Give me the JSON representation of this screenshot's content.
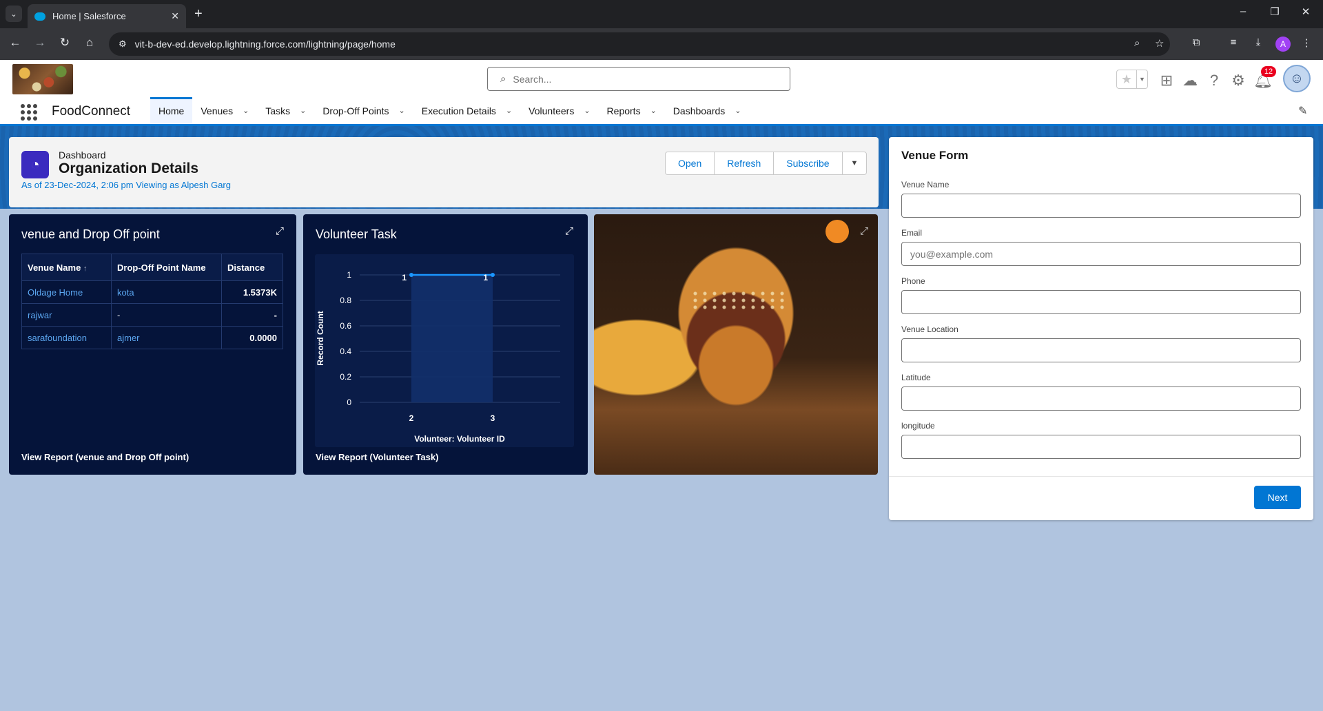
{
  "browser": {
    "tab_title": "Home | Salesforce",
    "url": "vit-b-dev-ed.develop.lightning.force.com/lightning/page/home",
    "profile_initial": "A"
  },
  "header": {
    "search_placeholder": "Search...",
    "notification_count": "12"
  },
  "nav": {
    "app_name": "FoodConnect",
    "items": [
      {
        "label": "Home",
        "active": true,
        "dropdown": false
      },
      {
        "label": "Venues",
        "active": false,
        "dropdown": true
      },
      {
        "label": "Tasks",
        "active": false,
        "dropdown": true
      },
      {
        "label": "Drop-Off Points",
        "active": false,
        "dropdown": true
      },
      {
        "label": "Execution Details",
        "active": false,
        "dropdown": true
      },
      {
        "label": "Volunteers",
        "active": false,
        "dropdown": true
      },
      {
        "label": "Reports",
        "active": false,
        "dropdown": true
      },
      {
        "label": "Dashboards",
        "active": false,
        "dropdown": true
      }
    ]
  },
  "dashboard": {
    "type_label": "Dashboard",
    "title": "Organization Details",
    "as_of": "As of 23-Dec-2024, 2:06 pm Viewing as Alpesh Garg",
    "buttons": {
      "open": "Open",
      "refresh": "Refresh",
      "subscribe": "Subscribe"
    }
  },
  "widget_table": {
    "title": "venue and Drop Off point",
    "columns": [
      "Venue Name",
      "Drop-Off Point Name",
      "Distance"
    ],
    "sort_indicator": "↑",
    "rows": [
      [
        "Oldage Home",
        "kota",
        "1.5373K"
      ],
      [
        "rajwar",
        "-",
        "-"
      ],
      [
        "sarafoundation",
        "ajmer",
        "0.0000"
      ]
    ],
    "view_report": "View Report (venue and Drop Off point)"
  },
  "widget_chart": {
    "title": "Volunteer Task",
    "view_report": "View Report (Volunteer Task)"
  },
  "chart_data": {
    "type": "line",
    "x": [
      "2",
      "3"
    ],
    "values": [
      1,
      1
    ],
    "data_labels": [
      "1",
      "1"
    ],
    "xlabel": "Volunteer: Volunteer ID",
    "ylabel": "Record Count",
    "yticks": [
      "1",
      "0.8",
      "0.6",
      "0.4",
      "0.2",
      "0"
    ],
    "ylim": [
      0,
      1
    ],
    "grid": true,
    "line_color": "#1b96ff"
  },
  "widget_image": {
    "subject": "burger-and-fries-photo"
  },
  "venue_form": {
    "title": "Venue Form",
    "fields": [
      {
        "label": "Venue Name",
        "value": "",
        "placeholder": ""
      },
      {
        "label": "Email",
        "value": "",
        "placeholder": "you@example.com"
      },
      {
        "label": "Phone",
        "value": "",
        "placeholder": ""
      },
      {
        "label": "Venue Location",
        "value": "",
        "placeholder": ""
      },
      {
        "label": "Latitude",
        "value": "",
        "placeholder": ""
      },
      {
        "label": "longitude",
        "value": "",
        "placeholder": ""
      }
    ],
    "next_label": "Next"
  },
  "colors": {
    "brand_blue": "#0176d3",
    "widget_bg": "#05143a",
    "page_bg": "#b0c4df",
    "dashboard_icon": "#3b2bbf"
  }
}
